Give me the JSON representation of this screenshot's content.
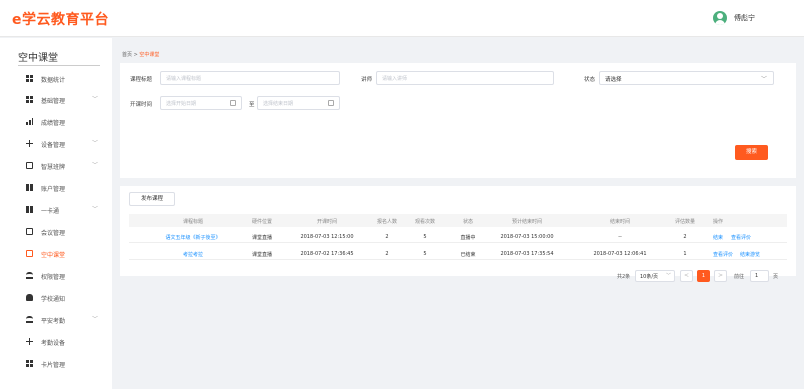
{
  "header": {
    "logo": "e学云教育平台",
    "username": "傅彪宁"
  },
  "sidebar": {
    "title": "空中课堂",
    "items": [
      {
        "label": "数据统计",
        "icon": "grid-icon",
        "expandable": false
      },
      {
        "label": "基础管理",
        "icon": "grid-icon",
        "expandable": true
      },
      {
        "label": "成绩管理",
        "icon": "bar-chart-icon",
        "expandable": false
      },
      {
        "label": "设备管理",
        "icon": "plus-icon",
        "expandable": true
      },
      {
        "label": "智慧班牌",
        "icon": "device-icon",
        "expandable": true
      },
      {
        "label": "账户管理",
        "icon": "book-icon",
        "expandable": false
      },
      {
        "label": "一卡通",
        "icon": "book-icon",
        "expandable": true
      },
      {
        "label": "会议管理",
        "icon": "box-icon",
        "expandable": false
      },
      {
        "label": "空中课堂",
        "icon": "screen-icon",
        "expandable": false,
        "active": true
      },
      {
        "label": "权限管理",
        "icon": "lock-icon",
        "expandable": false
      },
      {
        "label": "学校通知",
        "icon": "bell-icon",
        "expandable": false
      },
      {
        "label": "平安考勤",
        "icon": "lock-icon",
        "expandable": true
      },
      {
        "label": "考勤设备",
        "icon": "plus-icon",
        "expandable": false
      },
      {
        "label": "卡片管理",
        "icon": "grid-icon",
        "expandable": false
      }
    ]
  },
  "breadcrumb": {
    "home": "首页",
    "sep": ">",
    "current": "空中课堂"
  },
  "filters": {
    "title_label": "课程标题",
    "title_placeholder": "请输入课程标题",
    "teacher_label": "讲师",
    "teacher_placeholder": "请输入讲师",
    "status_label": "状态",
    "status_value": "请选择",
    "time_label": "开课时间",
    "start_placeholder": "选择开始日期",
    "to_label": "至",
    "end_placeholder": "选择结束日期",
    "search_label": "搜索"
  },
  "table": {
    "publish_label": "发布课程",
    "headers": [
      "课程标题",
      "硬件位置",
      "开课时间",
      "报名人数",
      "观看次数",
      "状态",
      "预计结束时间",
      "结束时间",
      "评估数量",
      "操作"
    ],
    "rows": [
      {
        "title": "语文五年级《新子後至》",
        "location": "课堂直播",
        "start": "2018-07-03 12:15:00",
        "signups": "2",
        "views": "5",
        "status": "直播中",
        "expected_end": "2018-07-03 15:00:00",
        "end": "--",
        "evaluations": "2",
        "actions": [
          "结束",
          "查看评价"
        ]
      },
      {
        "title": "考拉考拉",
        "location": "课堂直播",
        "start": "2018-07-02 17:36:45",
        "signups": "2",
        "views": "5",
        "status": "已结束",
        "expected_end": "2018-07-03 17:35:54",
        "end": "2018-07-03 12:06:41",
        "evaluations": "1",
        "actions": [
          "查看评价",
          "结束游览"
        ]
      }
    ]
  },
  "pagination": {
    "total": "共2条",
    "page_size": "10条/页",
    "prev": "<",
    "current_page": "1",
    "next": ">",
    "goto_label": "前往",
    "goto_value": "1",
    "page_suffix": "页"
  },
  "colors": {
    "accent": "#ff5a1f",
    "link": "#1890ff"
  }
}
